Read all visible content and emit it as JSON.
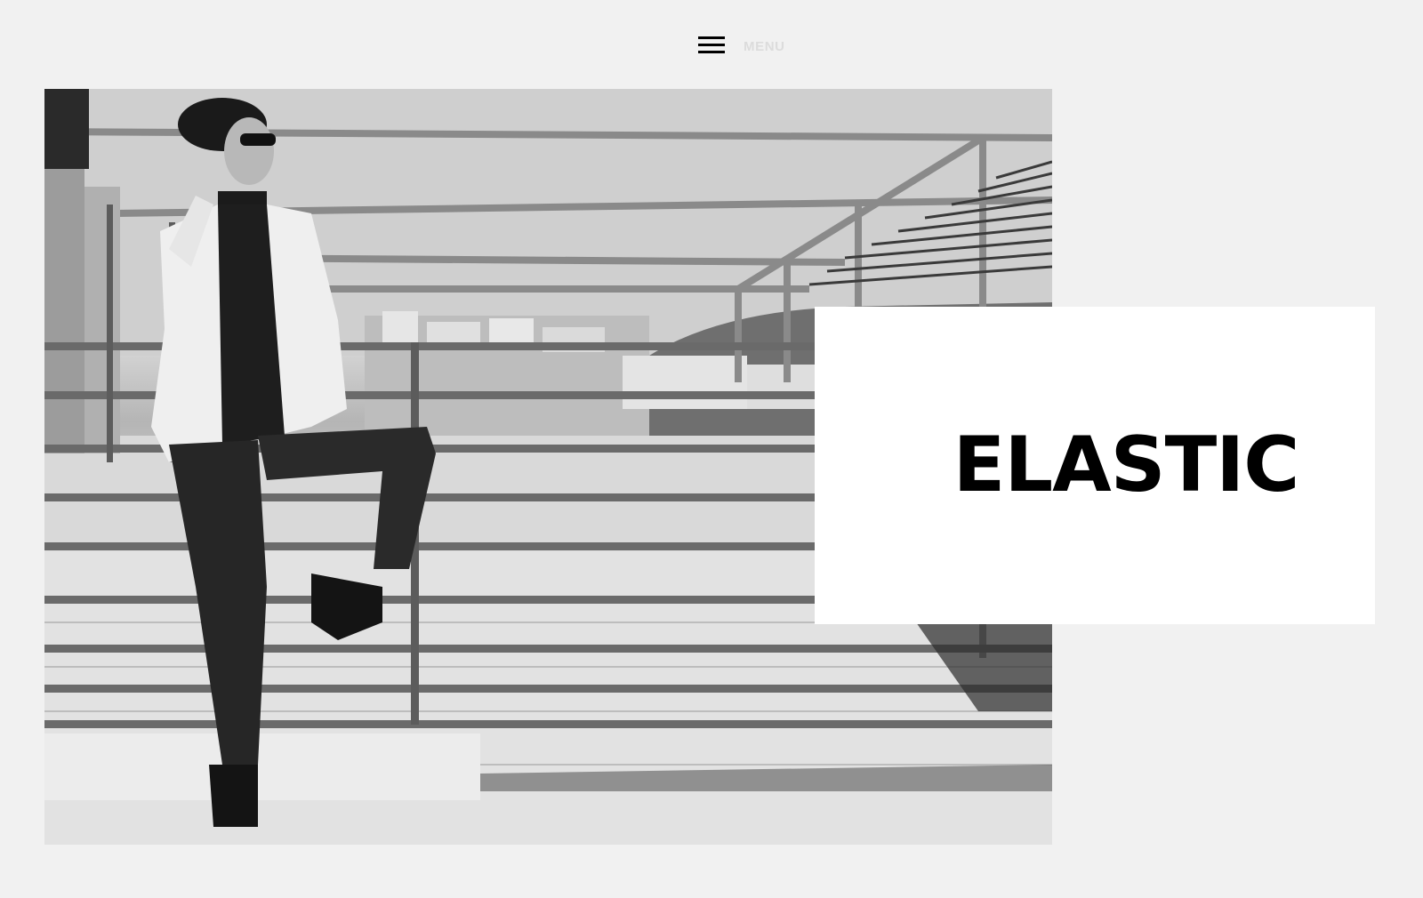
{
  "header": {
    "menu_label": "MENU",
    "menu_icon": "hamburger-icon"
  },
  "hero": {
    "image_description_icon": "photo"
  },
  "title_card": {
    "site_title": "ELASTIC"
  },
  "colors": {
    "page_background": "#f1f1f1",
    "card_background": "#ffffff",
    "title_text": "#000000",
    "menu_label_text": "#dcdcdc"
  }
}
